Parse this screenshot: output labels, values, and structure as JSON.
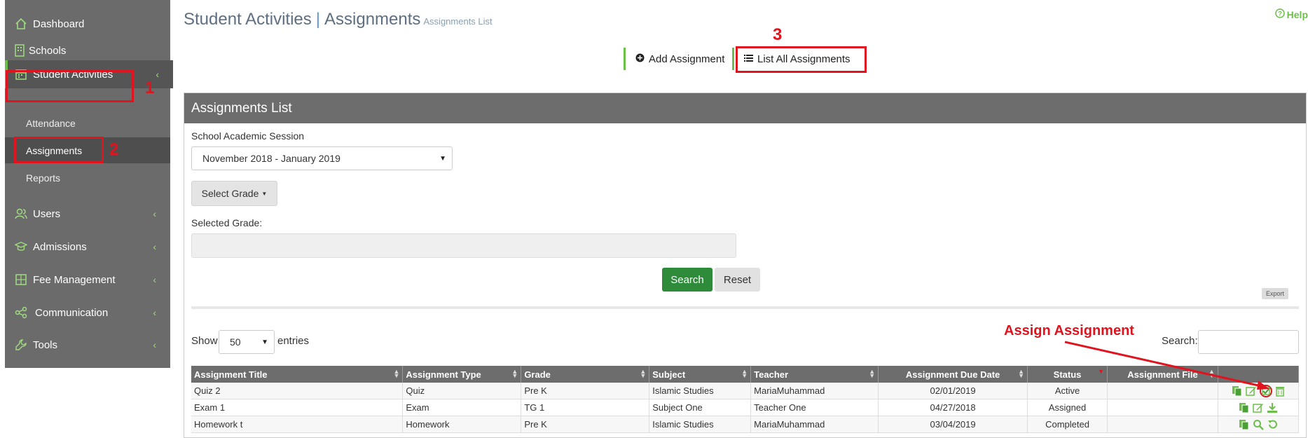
{
  "sidebar": {
    "items": [
      {
        "label": "Dashboard",
        "icon": "home-icon"
      },
      {
        "label": "Schools",
        "icon": "building-icon"
      },
      {
        "label": "Student Activities",
        "icon": "calendar-icon"
      },
      {
        "label": "Users",
        "icon": "users-icon"
      },
      {
        "label": "Admissions",
        "icon": "graduation-cap-icon"
      },
      {
        "label": "Fee Management",
        "icon": "calculator-icon"
      },
      {
        "label": "Communication",
        "icon": "share-icon"
      },
      {
        "label": "Tools",
        "icon": "wrench-icon"
      }
    ],
    "subitems": [
      {
        "label": "Attendance"
      },
      {
        "label": "Assignments"
      },
      {
        "label": "Reports"
      }
    ]
  },
  "header": {
    "title": "Student Activities",
    "sep": "|",
    "subtitle": "Assignments",
    "small": "Assignments List",
    "help": "Help"
  },
  "tabs": {
    "add": "Add Assignment",
    "list": "List All Assignments"
  },
  "panel": {
    "title": "Assignments List",
    "session_label": "School Academic Session",
    "session_value": "November 2018 - January 2019",
    "grade_button": "Select Grade",
    "selected_grade_label": "Selected Grade:",
    "search_button": "Search",
    "reset_button": "Reset",
    "export_button": "Export",
    "show_label": "Show",
    "entries_value": "50",
    "entries_label": "entries",
    "search_label": "Search:"
  },
  "table": {
    "columns": [
      "Assignment Title",
      "Assignment Type",
      "Grade",
      "Subject",
      "Teacher",
      "Assignment Due Date",
      "Status",
      "Assignment File",
      ""
    ],
    "rows": [
      {
        "title": "Quiz 2",
        "type": "Quiz",
        "grade": "Pre K",
        "subject": "Islamic Studies",
        "teacher": "MariaMuhammad",
        "due": "02/01/2019",
        "status": "Active",
        "file": ""
      },
      {
        "title": "Exam 1",
        "type": "Exam",
        "grade": "TG 1",
        "subject": "Subject One",
        "teacher": "Teacher One",
        "due": "04/27/2018",
        "status": "Assigned",
        "file": ""
      },
      {
        "title": "Homework t",
        "type": "Homework",
        "grade": "Pre K",
        "subject": "Islamic Studies",
        "teacher": "MariaMuhammad",
        "due": "03/04/2019",
        "status": "Completed",
        "file": ""
      }
    ]
  },
  "annotations": {
    "n1": "1",
    "n2": "2",
    "n3": "3",
    "assign_label": "Assign Assignment"
  },
  "colors": {
    "accent_green": "#6cc04a",
    "annotation_red": "#e0141e",
    "sidebar_bg": "#6b6b6b",
    "search_green": "#2e8b3a"
  }
}
